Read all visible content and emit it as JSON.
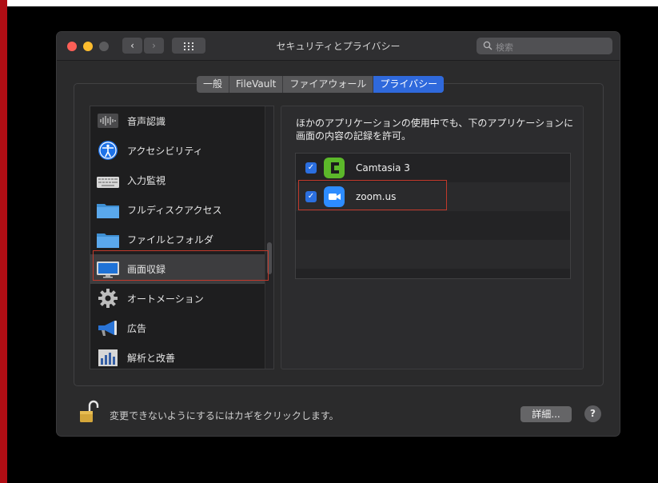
{
  "window": {
    "title": "セキュリティとプライバシー",
    "search_placeholder": "検索",
    "nav_back": "‹",
    "nav_forward": "›"
  },
  "tabs": [
    {
      "label": "一般",
      "active": false
    },
    {
      "label": "FileVault",
      "active": false
    },
    {
      "label": "ファイアウォール",
      "active": false
    },
    {
      "label": "プライバシー",
      "active": true
    }
  ],
  "sidebar": {
    "items": [
      {
        "label": "音声認識",
        "icon": "waveform-icon"
      },
      {
        "label": "アクセシビリティ",
        "icon": "accessibility-icon"
      },
      {
        "label": "入力監視",
        "icon": "keyboard-icon"
      },
      {
        "label": "フルディスクアクセス",
        "icon": "folder-icon"
      },
      {
        "label": "ファイルとフォルダ",
        "icon": "folder-icon"
      },
      {
        "label": "画面収録",
        "icon": "display-icon",
        "selected": true
      },
      {
        "label": "オートメーション",
        "icon": "gear-icon"
      },
      {
        "label": "広告",
        "icon": "megaphone-icon"
      },
      {
        "label": "解析と改善",
        "icon": "chart-icon"
      }
    ]
  },
  "panel": {
    "description": "ほかのアプリケーションの使用中でも、下のアプリケーションに画面の内容の記録を許可。",
    "apps": [
      {
        "name": "Camtasia 3",
        "checked": true,
        "icon": "camtasia-icon",
        "color": "#5cb82a"
      },
      {
        "name": "zoom.us",
        "checked": true,
        "icon": "zoom-video-icon",
        "color": "#2d8cff"
      }
    ]
  },
  "footer": {
    "lock_text": "変更できないようにするにはカギをクリックします。",
    "advanced_label": "詳細...",
    "help_label": "?"
  },
  "colors": {
    "accent": "#2f69dc",
    "highlight_border": "#c2392b"
  }
}
